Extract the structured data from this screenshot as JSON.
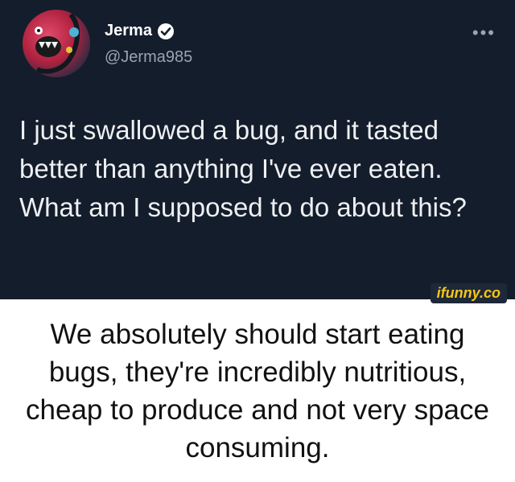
{
  "tweet": {
    "display_name": "Jerma",
    "handle": "@Jerma985",
    "verified_icon": "verified-badge-icon",
    "more_icon": "more-horizontal-icon",
    "text": "I just swallowed a bug, and it tasted better than anything I've ever eaten. What am I supposed to do about this?"
  },
  "watermark": "ifunny.co",
  "caption": "We absolutely should start eating bugs, they're incredibly nutritious, cheap to produce and not very space consuming.",
  "colors": {
    "tweet_background": "#141d2b",
    "verified": "#1d9bf0",
    "watermark": "#f5c518"
  }
}
